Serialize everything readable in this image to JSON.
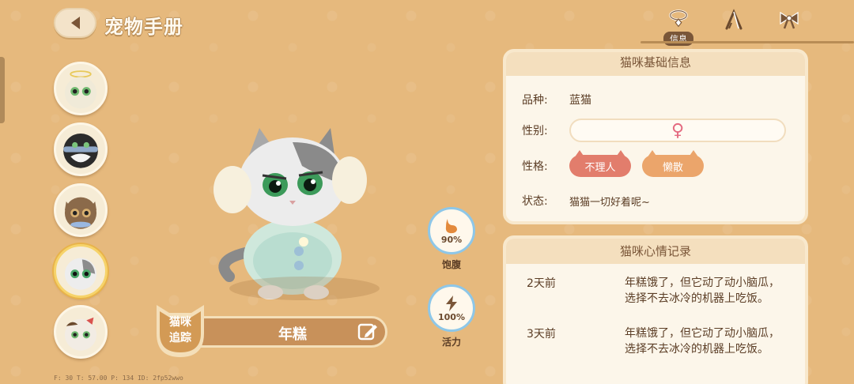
{
  "header": {
    "title": "宠物手册",
    "tabs": [
      {
        "icon": "collar-icon",
        "label": "信息",
        "active": true
      },
      {
        "icon": "hanger-icon",
        "label": ""
      },
      {
        "icon": "bow-icon",
        "label": ""
      }
    ]
  },
  "avatars": [
    {
      "name": "cat-angel",
      "selected": false
    },
    {
      "name": "cat-tuxedo",
      "selected": false
    },
    {
      "name": "cat-tabby",
      "selected": false
    },
    {
      "name": "cat-niangao",
      "selected": true
    },
    {
      "name": "cat-bow",
      "selected": false
    }
  ],
  "stats": {
    "satiety": {
      "value": 90,
      "text": "90%",
      "label": "饱腹"
    },
    "energy": {
      "value": 100,
      "text": "100%",
      "label": "活力"
    }
  },
  "tracker": {
    "badge_line1": "猫咪",
    "badge_line2": "追踪",
    "cat_name": "年糕"
  },
  "debug": "F: 30   T: 57.00   P: 134   ID: 2fp52wwo",
  "basic_info": {
    "title": "猫咪基础信息",
    "breed_key": "品种:",
    "breed": "蓝猫",
    "gender_key": "性别:",
    "gender_symbol": "♀",
    "personality_key": "性格:",
    "traits": [
      "不理人",
      "懒散"
    ],
    "status_key": "状态:",
    "status": "猫猫一切好着呢~"
  },
  "mood_log": {
    "title": "猫咪心情记录",
    "entries": [
      {
        "time": "2天前",
        "text": "年糕饿了，但它动了动小脑瓜，选择不去冰冷的机器上吃饭。"
      },
      {
        "time": "3天前",
        "text": "年糕饿了，但它动了动小脑瓜，选择不去冰冷的机器上吃饭。"
      }
    ]
  },
  "colors": {
    "background": "#e6b97d",
    "ring": "#8ec7e8",
    "trait1": "#e27d6c",
    "trait2": "#eba56b"
  }
}
